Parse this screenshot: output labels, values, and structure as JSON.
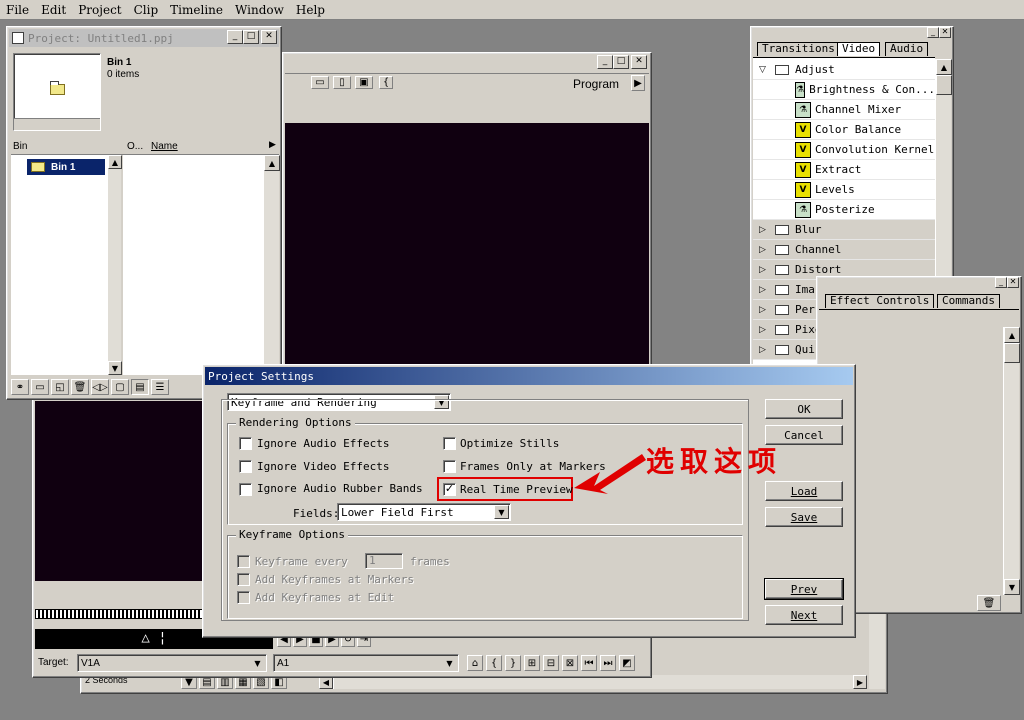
{
  "menu": [
    "File",
    "Edit",
    "Project",
    "Clip",
    "Timeline",
    "Window",
    "Help"
  ],
  "project_window": {
    "title": "Project: Untitled1.ppj",
    "bin_name": "Bin 1",
    "bin_items": "0 items",
    "col_bin": "Bin",
    "col_o": "O...",
    "col_name": "Name",
    "tree_item": "Bin 1"
  },
  "monitor": {
    "program_label": "Program"
  },
  "timeline": {
    "target_label": "Target:",
    "v_target": "V1A",
    "a_target": "A1",
    "zoom": "2 Seconds"
  },
  "effects_palette": {
    "tabs": [
      "Transitions",
      "Video",
      "Audio"
    ],
    "selected_tab": "Video",
    "open_folder": "Adjust",
    "effects": [
      {
        "name": "Brightness & Con...",
        "icon": "fx-icon"
      },
      {
        "name": "Channel Mixer",
        "icon": "fx-icon"
      },
      {
        "name": "Color Balance",
        "icon": "v-icon"
      },
      {
        "name": "Convolution Kernel",
        "icon": "v-icon"
      },
      {
        "name": "Extract",
        "icon": "v-icon"
      },
      {
        "name": "Levels",
        "icon": "v-icon"
      },
      {
        "name": "Posterize",
        "icon": "fx-icon"
      }
    ],
    "folders": [
      "Blur",
      "Channel",
      "Distort",
      "Ima",
      "Pers",
      "Pixe",
      "Qui"
    ]
  },
  "effect_controls": {
    "tabs": [
      "Effect Controls",
      "Commands"
    ]
  },
  "dialog": {
    "title": "Project Settings",
    "section_select": "Keyframe and Rendering",
    "rendering_group": "Rendering Options",
    "options": [
      {
        "label": "Ignore Audio Effects",
        "checked": false
      },
      {
        "label": "Ignore Video Effects",
        "checked": false
      },
      {
        "label": "Ignore Audio Rubber Bands",
        "checked": false
      },
      {
        "label": "Optimize Stills",
        "checked": false
      },
      {
        "label": "Frames Only at Markers",
        "checked": false
      },
      {
        "label": "Real Time Preview",
        "checked": true
      }
    ],
    "fields_label": "Fields:",
    "fields_value": "Lower Field First",
    "keyframe_group": "Keyframe Options",
    "keyframe_every": "Keyframe every",
    "keyframe_value": "1",
    "frames_label": "frames",
    "add_markers": "Add Keyframes at Markers",
    "add_edit": "Add Keyframes at Edit",
    "buttons": {
      "ok": "OK",
      "cancel": "Cancel",
      "load": "Load",
      "save": "Save",
      "prev": "Prev",
      "next": "Next"
    }
  },
  "annotation": {
    "text": "选取这项",
    "color": "#e00000"
  }
}
